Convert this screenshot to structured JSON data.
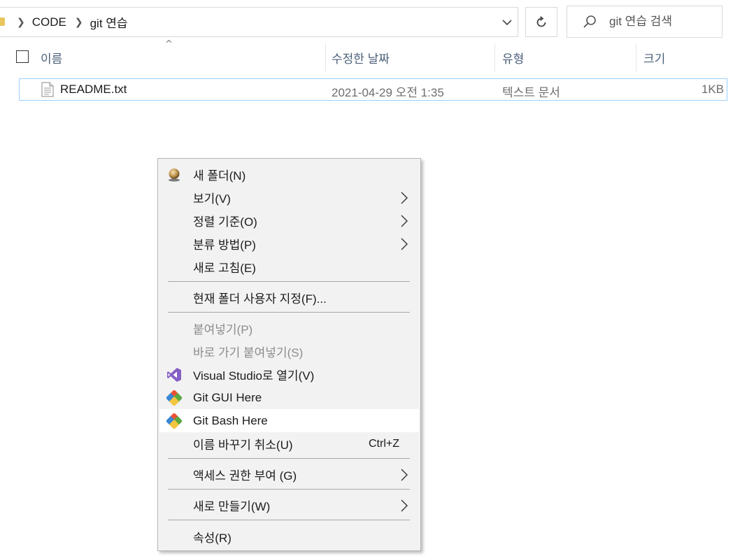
{
  "address_bar": {
    "breadcrumbs": [
      "CODE",
      "git 연습"
    ],
    "dropdown_icon": "chevron-down",
    "refresh_icon": "refresh"
  },
  "search": {
    "placeholder": "git 연습 검색",
    "icon": "search"
  },
  "columns": {
    "name": "이름",
    "date": "수정한 날짜",
    "type": "유형",
    "size": "크기",
    "sort_indicator": "^"
  },
  "files": [
    {
      "name": "README.txt",
      "date": "2021-04-29 오전 1:35",
      "type": "텍스트 문서",
      "size": "1KB",
      "icon": "text-file"
    }
  ],
  "context_menu": {
    "items": [
      {
        "label": "새 폴더(N)",
        "icon": "new-folder"
      },
      {
        "label": "보기(V)",
        "submenu": true
      },
      {
        "label": "정렬 기준(O)",
        "submenu": true
      },
      {
        "label": "분류 방법(P)",
        "submenu": true
      },
      {
        "label": "새로 고침(E)"
      },
      {
        "label": "현재 폴더 사용자 지정(F)..."
      },
      {
        "label": "붙여넣기(P)",
        "disabled": true
      },
      {
        "label": "바로 가기 붙여넣기(S)",
        "disabled": true
      },
      {
        "label": "Visual Studio로 열기(V)",
        "icon": "visual-studio"
      },
      {
        "label": "Git GUI Here",
        "icon": "git"
      },
      {
        "label": "Git Bash Here",
        "icon": "git",
        "highlighted": true
      },
      {
        "label": "이름 바꾸기 취소(U)",
        "shortcut": "Ctrl+Z"
      },
      {
        "label": "액세스 권한 부여 (G)",
        "submenu": true
      },
      {
        "label": "새로 만들기(W)",
        "submenu": true
      },
      {
        "label": "속성(R)"
      }
    ]
  },
  "colors": {
    "selection_border": "#99d1ff",
    "menu_background": "#f2f2f2",
    "menu_hover": "#ffffff",
    "header_text": "#4c607a",
    "git_orange": "#f05133",
    "visual_studio_purple": "#865fc5"
  }
}
